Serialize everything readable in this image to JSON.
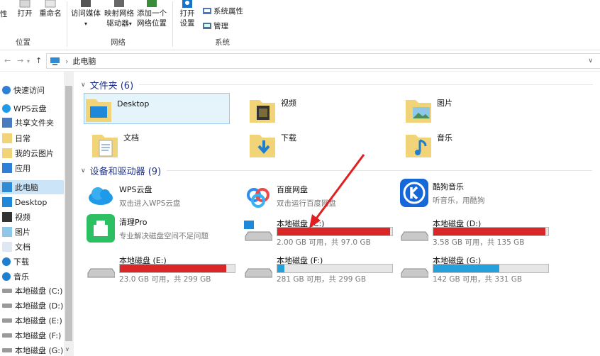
{
  "ribbon": {
    "open_label": "打开",
    "rename_label": "重命名",
    "prop_partial": "性",
    "location_group": "位置",
    "media_label_1": "访问媒体",
    "map_label_1": "映射网络",
    "map_label_2": "驱动器",
    "addloc_label_1": "添加一个",
    "addloc_label_2": "网络位置",
    "network_group": "网络",
    "settings_label_1": "打开",
    "settings_label_2": "设置",
    "sysprop_label": "系统属性",
    "manage_label": "管理",
    "system_group": "系统"
  },
  "address": {
    "path": "此电脑"
  },
  "sidebar": {
    "items": [
      {
        "label": "快速访问",
        "icon": "star-icon"
      },
      {
        "label": "WPS云盘",
        "icon": "cloud-icon"
      },
      {
        "label": "共享文件夹",
        "icon": "share-icon"
      },
      {
        "label": "日常",
        "icon": "folder-icon"
      },
      {
        "label": "我的云图片",
        "icon": "folder-icon"
      },
      {
        "label": "应用",
        "icon": "apps-icon"
      },
      {
        "label": "此电脑",
        "icon": "computer-icon"
      },
      {
        "label": "Desktop",
        "icon": "desktop-icon"
      },
      {
        "label": "视频",
        "icon": "video-icon"
      },
      {
        "label": "图片",
        "icon": "picture-icon"
      },
      {
        "label": "文档",
        "icon": "document-icon"
      },
      {
        "label": "下载",
        "icon": "download-icon"
      },
      {
        "label": "音乐",
        "icon": "music-icon"
      },
      {
        "label": "本地磁盘 (C:)",
        "icon": "drive-icon"
      },
      {
        "label": "本地磁盘 (D:)",
        "icon": "drive-icon"
      },
      {
        "label": "本地磁盘 (E:)",
        "icon": "drive-icon"
      },
      {
        "label": "本地磁盘 (F:)",
        "icon": "drive-icon"
      },
      {
        "label": "本地磁盘 (G:)",
        "icon": "drive-icon"
      }
    ]
  },
  "folders": {
    "header": "文件夹 (6)",
    "items": [
      {
        "name": "Desktop",
        "icon": "desktop-folder-icon"
      },
      {
        "name": "视频",
        "icon": "video-folder-icon"
      },
      {
        "name": "图片",
        "icon": "picture-folder-icon"
      },
      {
        "name": "文档",
        "icon": "document-folder-icon"
      },
      {
        "name": "下载",
        "icon": "download-folder-icon"
      },
      {
        "name": "音乐",
        "icon": "music-folder-icon"
      }
    ]
  },
  "devices": {
    "header": "设备和驱动器 (9)",
    "apps": [
      {
        "name": "WPS云盘",
        "sub": "双击进入WPS云盘",
        "icon": "wps-cloud-icon"
      },
      {
        "name": "百度网盘",
        "sub": "双击运行百度网盘",
        "icon": "baidu-netdisk-icon"
      },
      {
        "name": "酷狗音乐",
        "sub": "听音乐，用酷狗",
        "icon": "kugou-icon"
      },
      {
        "name": "清理Pro",
        "sub": "专业解决磁盘空间不足问题",
        "icon": "cleanpro-icon"
      }
    ],
    "drives": [
      {
        "name": "本地磁盘 (C:)",
        "info": "2.00 GB 可用，共 97.0 GB",
        "used": 0.979,
        "color": "#da2626"
      },
      {
        "name": "本地磁盘 (D:)",
        "info": "3.58 GB 可用，共 135 GB",
        "used": 0.973,
        "color": "#da2626"
      },
      {
        "name": "本地磁盘 (E:)",
        "info": "23.0 GB 可用，共 299 GB",
        "used": 0.923,
        "color": "#da2626"
      },
      {
        "name": "本地磁盘 (F:)",
        "info": "281 GB 可用，共 299 GB",
        "used": 0.06,
        "color": "#26a0da"
      },
      {
        "name": "本地磁盘 (G:)",
        "info": "142 GB 可用，共 331 GB",
        "used": 0.571,
        "color": "#26a0da"
      }
    ]
  },
  "colors": {
    "accent": "#0078d7",
    "selection": "#cce4f7",
    "warning_bar": "#da2626",
    "normal_bar": "#26a0da",
    "annotation_arrow": "#e02020"
  }
}
